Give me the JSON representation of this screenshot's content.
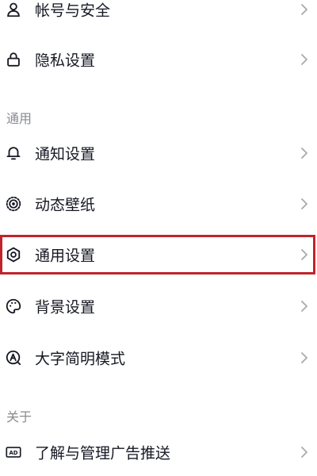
{
  "account_section": {
    "items": [
      {
        "label": "帐号与安全",
        "icon": "person-icon"
      },
      {
        "label": "隐私设置",
        "icon": "lock-icon"
      }
    ]
  },
  "general_section": {
    "header": "通用",
    "items": [
      {
        "label": "通知设置",
        "icon": "bell-icon"
      },
      {
        "label": "动态壁纸",
        "icon": "live-wallpaper-icon"
      },
      {
        "label": "通用设置",
        "icon": "gear-icon"
      },
      {
        "label": "背景设置",
        "icon": "palette-icon"
      },
      {
        "label": "大字简明模式",
        "icon": "large-font-icon"
      }
    ]
  },
  "about_section": {
    "header": "关于",
    "items": [
      {
        "label": "了解与管理广告推送",
        "icon": "ad-icon"
      }
    ]
  },
  "colors": {
    "highlight_border": "#c0242b",
    "text": "#161823",
    "section_header": "#8a8b91",
    "chevron": "#a8a9ad"
  }
}
